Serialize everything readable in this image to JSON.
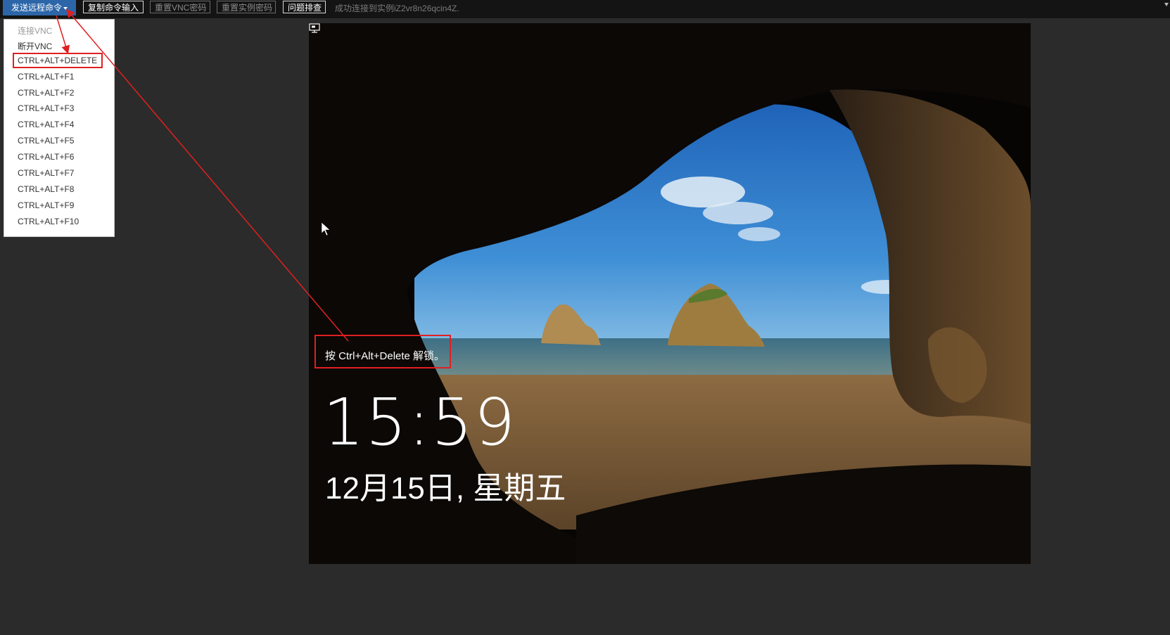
{
  "toolbar": {
    "send_remote_command": "发送远程命令",
    "copy_command_input": "复制命令输入",
    "reset_vnc_password": "重置VNC密码",
    "reset_instance_password": "重置实例密码",
    "troubleshoot": "问题排查",
    "status_message": "成功连接到实例iZ2vr8n26qcin4Z."
  },
  "dropdown": {
    "items": [
      {
        "label": "连接VNC",
        "enabled": false
      },
      {
        "label": "断开VNC",
        "enabled": true
      },
      {
        "label": "CTRL+ALT+DELETE",
        "enabled": true,
        "highlighted": true
      },
      {
        "label": "CTRL+ALT+F1",
        "enabled": true
      },
      {
        "label": "CTRL+ALT+F2",
        "enabled": true
      },
      {
        "label": "CTRL+ALT+F3",
        "enabled": true
      },
      {
        "label": "CTRL+ALT+F4",
        "enabled": true
      },
      {
        "label": "CTRL+ALT+F5",
        "enabled": true
      },
      {
        "label": "CTRL+ALT+F6",
        "enabled": true
      },
      {
        "label": "CTRL+ALT+F7",
        "enabled": true
      },
      {
        "label": "CTRL+ALT+F8",
        "enabled": true
      },
      {
        "label": "CTRL+ALT+F9",
        "enabled": true
      },
      {
        "label": "CTRL+ALT+F10",
        "enabled": true
      }
    ]
  },
  "lockscreen": {
    "unlock_hint": "按 Ctrl+Alt+Delete 解锁。",
    "time": "15:59",
    "date": "12月15日, 星期五",
    "network_icon": "network-monitor-icon"
  },
  "colors": {
    "accent": "#2c66a8",
    "annotation": "#e02020",
    "background": "#2b2b2b"
  }
}
